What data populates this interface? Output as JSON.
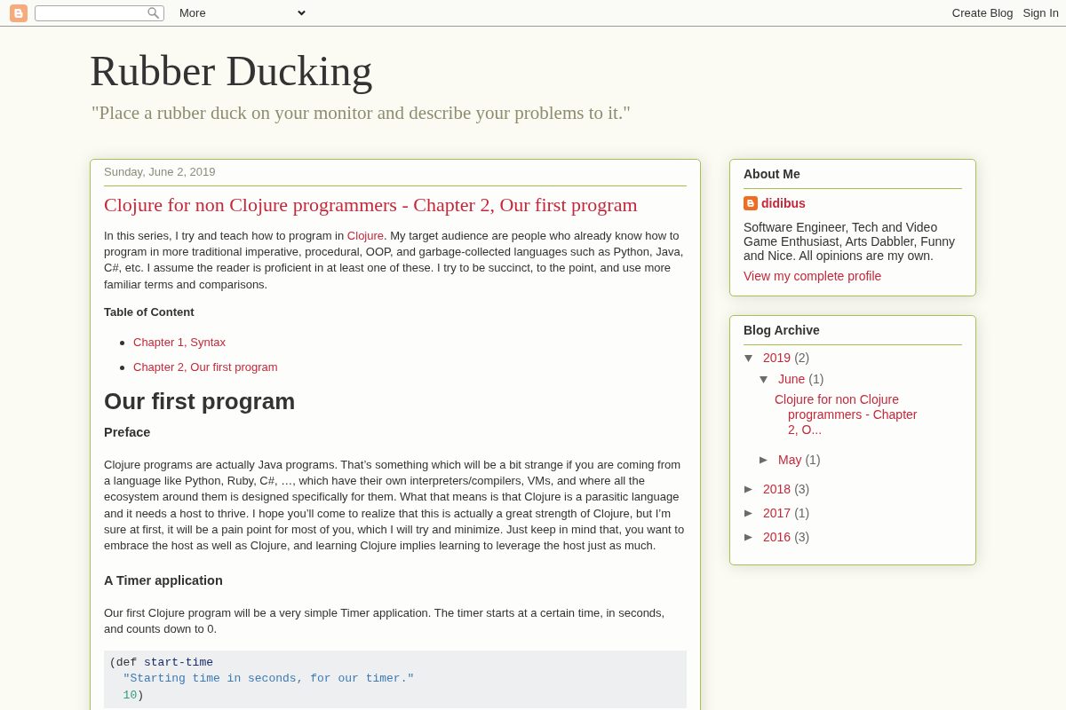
{
  "navbar": {
    "menu": {
      "label": "More"
    },
    "links": [
      "Create Blog",
      "Sign In"
    ]
  },
  "header": {
    "title": "Rubber Ducking",
    "description": "\"Place a rubber duck on your monitor and describe your problems to it.\""
  },
  "post": {
    "date": "Sunday, June 2, 2019",
    "title": "Clojure for non Clojure programmers - Chapter 2, Our first program",
    "body": [
      {
        "kind": "paragraph",
        "segments": [
          {
            "kind": "text",
            "text": "In this series, I try and teach how to program in "
          },
          {
            "kind": "link",
            "text": "Clojure"
          },
          {
            "kind": "text",
            "text": ". My target audience are people who already know how to program in more traditional imperative, procedural, OOP, and garbage-collected languages such as Python, Java, C#, etc. I assume the reader is proficient in at least one of these. I try to be succinct, to the point, and use more familiar terms and comparisons."
          }
        ]
      },
      {
        "kind": "label",
        "text": "Table of Content"
      },
      {
        "kind": "list",
        "items": [
          "Chapter 1, Syntax",
          "Chapter 2, Our first program"
        ]
      },
      {
        "kind": "heading",
        "text": "Our first program"
      },
      {
        "kind": "subheading",
        "text": "Preface"
      },
      {
        "kind": "paragraph",
        "segments": [
          {
            "kind": "text",
            "text": "Clojure programs are actually Java programs. That’s something which will be a bit strange if you are coming from a language like Python, Ruby, C#, …, which have their own interpreters/compilers, VMs, and where all the ecosystem around them is designed specifically for them. What that means is that Clojure is a parasitic language and it needs a host to thrive. I hope you’ll come to realize that this is actually a great strength of Clojure, but I’m sure at first, it will be a pain point for most of you, which I will try and minimize. Just keep in mind that, you want to embrace the host as well as Clojure, and learning Clojure implies learning to leverage the host just as much."
          }
        ]
      },
      {
        "kind": "subheading",
        "text": "A Timer application"
      },
      {
        "kind": "paragraph",
        "segments": [
          {
            "kind": "text",
            "text": "Our first Clojure program will be a very simple Timer application. The timer starts at a certain time, in seconds, and counts down to 0."
          }
        ]
      },
      {
        "kind": "code",
        "lines": [
          {
            "indented": false,
            "tokens": [
              {
                "kind": "plain",
                "text": "(def "
              },
              {
                "kind": "symbol",
                "text": "start-time"
              }
            ]
          },
          {
            "indented": true,
            "tokens": [
              {
                "kind": "string",
                "text": "\"Starting time in seconds, for our timer.\""
              }
            ]
          },
          {
            "indented": true,
            "tokens": [
              {
                "kind": "number",
                "text": "10"
              },
              {
                "kind": "plain",
                "text": ")"
              }
            ]
          }
        ]
      }
    ]
  },
  "about": {
    "title": "About Me",
    "name": "didibus",
    "description": "Software Engineer, Tech and Video Game Enthusiast, Arts Dabbler, Funny and Nice. All opinions are my own.",
    "profile_link": "View my complete profile"
  },
  "archive": {
    "title": "Blog Archive",
    "items": [
      {
        "kind": "period",
        "label": "2019",
        "count": "(2)",
        "expanded": true,
        "children": [
          {
            "kind": "period",
            "label": "June",
            "count": "(1)",
            "expanded": true,
            "children": [
              {
                "kind": "post",
                "label": "Clojure for non Clojure programmers - Chapter 2, O..."
              }
            ]
          },
          {
            "kind": "period",
            "label": "May",
            "count": "(1)",
            "expanded": false
          }
        ]
      },
      {
        "kind": "period",
        "label": "2018",
        "count": "(3)",
        "expanded": false
      },
      {
        "kind": "period",
        "label": "2017",
        "count": "(1)",
        "expanded": false
      },
      {
        "kind": "period",
        "label": "2016",
        "count": "(3)",
        "expanded": false
      }
    ]
  }
}
